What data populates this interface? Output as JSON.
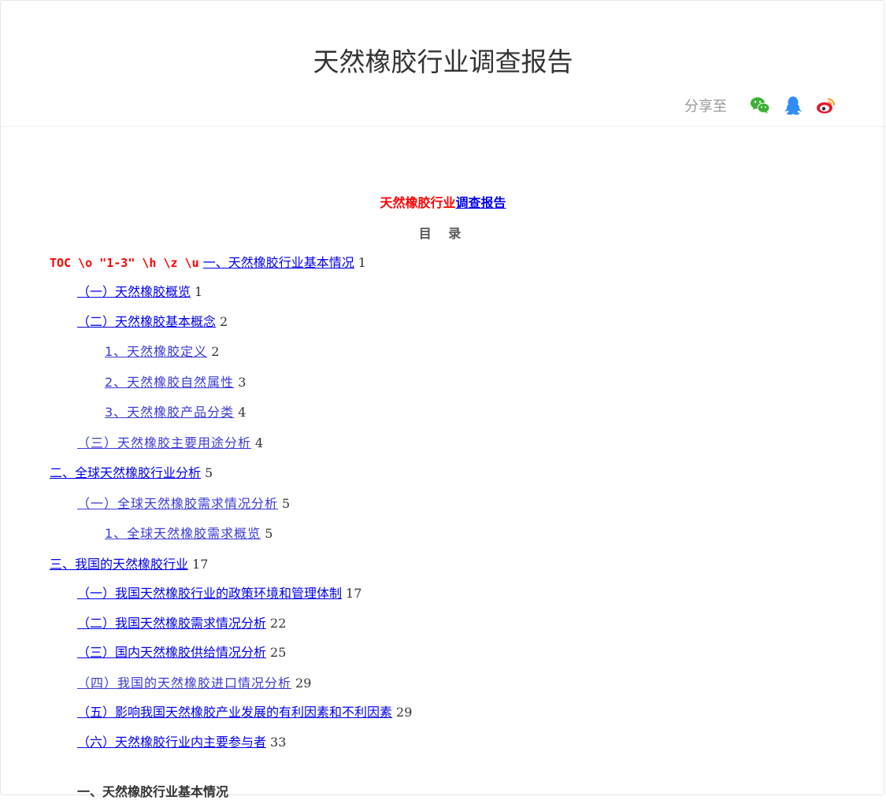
{
  "header": {
    "title": "天然橡胶行业调查报告",
    "share_label": "分享至",
    "share_icons": [
      "wechat-icon",
      "qq-icon",
      "weibo-icon"
    ]
  },
  "doc": {
    "title_red": "天然橡胶行业",
    "title_link": "调查报告",
    "toc_heading": "目 录",
    "toc_code": "TOC \\o \"1-3\" \\h \\z \\u",
    "toc": [
      {
        "text": "一、天然橡胶行业基本情况",
        "page": "1"
      },
      {
        "text": "（一）天然橡胶概览",
        "page": "1"
      },
      {
        "text": "（二）天然橡胶基本概念",
        "page": "2"
      },
      {
        "text": "1、天然橡胶定义",
        "page": "2"
      },
      {
        "text": "2、天然橡胶自然属性",
        "page": "3"
      },
      {
        "text": "3、天然橡胶产品分类",
        "page": "4"
      },
      {
        "text": "（三）天然橡胶主要用途分析",
        "page": "4"
      },
      {
        "text": "二、全球天然橡胶行业分析",
        "page": "5"
      },
      {
        "text": "（一）全球天然橡胶需求情况分析",
        "page": "5"
      },
      {
        "text": "1、全球天然橡胶需求概览",
        "page": "5"
      },
      {
        "text": "三、我国的天然橡胶行业",
        "page": "17"
      },
      {
        "text": "（一）我国天然橡胶行业的政策环境和管理体制",
        "page": "17"
      },
      {
        "text": "（二）我国天然橡胶需求情况分析",
        "page": "22"
      },
      {
        "text": "（三）国内天然橡胶供给情况分析",
        "page": "25"
      },
      {
        "text": "（四）我国的天然橡胶进口情况分析",
        "page": "29"
      },
      {
        "text": "（五）影响我国天然橡胶产业发展的有利因素和不利因素",
        "page": "29"
      },
      {
        "text": "（六）天然橡胶行业内主要参与者",
        "page": "33"
      }
    ],
    "bottom_partial": "一、天然橡胶行业基本情况"
  },
  "colors": {
    "link": "#0000ee",
    "code_red": "#ff0000",
    "wechat": "#3cb034",
    "qq": "#2f8df5",
    "weibo": "#e6162d"
  }
}
